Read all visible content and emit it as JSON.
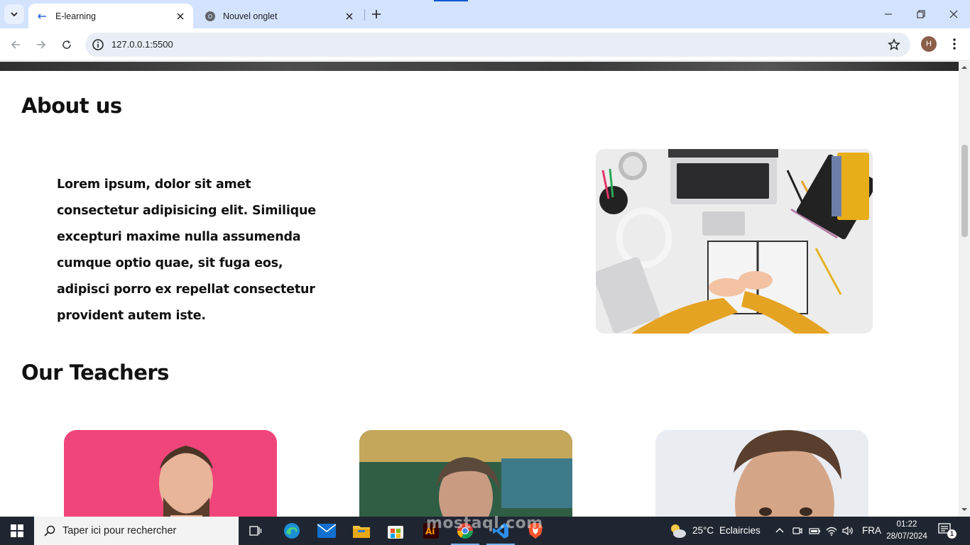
{
  "browser": {
    "tabs": [
      {
        "title": "E-learning",
        "active": true
      },
      {
        "title": "Nouvel onglet",
        "active": false
      }
    ],
    "url": "127.0.0.1:5500",
    "profile_initial": "H"
  },
  "page": {
    "about": {
      "title": "About us",
      "text": "Lorem ipsum, dolor sit amet consectetur adipisicing elit. Similique excepturi maxime nulla assumenda cumque optio quae, sit fuga eos, adipisci porro ex repellat consectetur provident autem iste.",
      "image": "desk-laptop-notebook-photo"
    },
    "teachers": {
      "title": "Our Teachers",
      "cards": [
        {
          "photo": "teacher-1-photo",
          "accent": "#f0457a"
        },
        {
          "photo": "teacher-2-photo",
          "accent": "#2e6b48"
        },
        {
          "photo": "teacher-3-photo",
          "accent": "#e6e9ee"
        }
      ]
    }
  },
  "taskbar": {
    "search_placeholder": "Taper ici pour rechercher",
    "weather": {
      "temp": "25°C",
      "label": "Eclaircies"
    },
    "language": "FRA",
    "time": "01:22",
    "date": "28/07/2024",
    "notification_count": "1",
    "apps": [
      "task-view-icon",
      "edge-icon",
      "mail-icon",
      "file-explorer-icon",
      "store-icon",
      "illustrator-icon",
      "chrome-icon",
      "vscode-icon",
      "brave-icon"
    ]
  },
  "watermark": "mostaql.com",
  "colors": {
    "tabbar": "#d3e3fd",
    "taskbar": "#202631",
    "accent": "#0b57d0"
  }
}
